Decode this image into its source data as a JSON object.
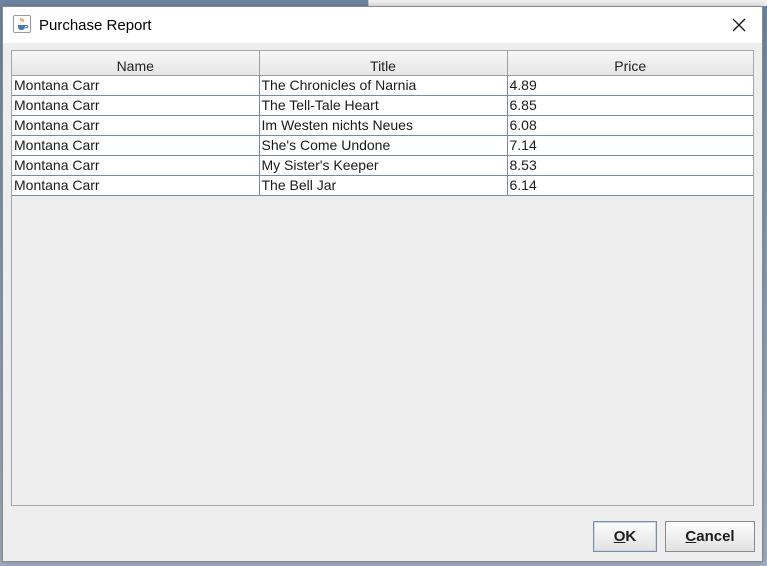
{
  "window": {
    "title": "Purchase Report"
  },
  "table": {
    "columns": [
      "Name",
      "Title",
      "Price"
    ],
    "rows": [
      [
        "Montana Carr",
        "The Chronicles of Narnia",
        "4.89"
      ],
      [
        "Montana Carr",
        "The Tell-Tale Heart",
        "6.85"
      ],
      [
        "Montana Carr",
        "Im Westen nichts Neues",
        "6.08"
      ],
      [
        "Montana Carr",
        "She's Come Undone",
        "7.14"
      ],
      [
        "Montana Carr",
        "My Sister's Keeper",
        "8.53"
      ],
      [
        "Montana Carr",
        "The Bell Jar",
        "6.14"
      ]
    ]
  },
  "buttons": {
    "ok": {
      "mnemonic": "O",
      "rest": "K"
    },
    "cancel": {
      "mnemonic": "C",
      "rest": "ancel"
    }
  },
  "icons": {
    "app": "java-coffee-cup-icon",
    "close": "close-icon"
  },
  "colors": {
    "dialog_background": "#eeeeee",
    "grid_line": "#7a8aa0",
    "default_button_border": "#7a8ca8"
  }
}
